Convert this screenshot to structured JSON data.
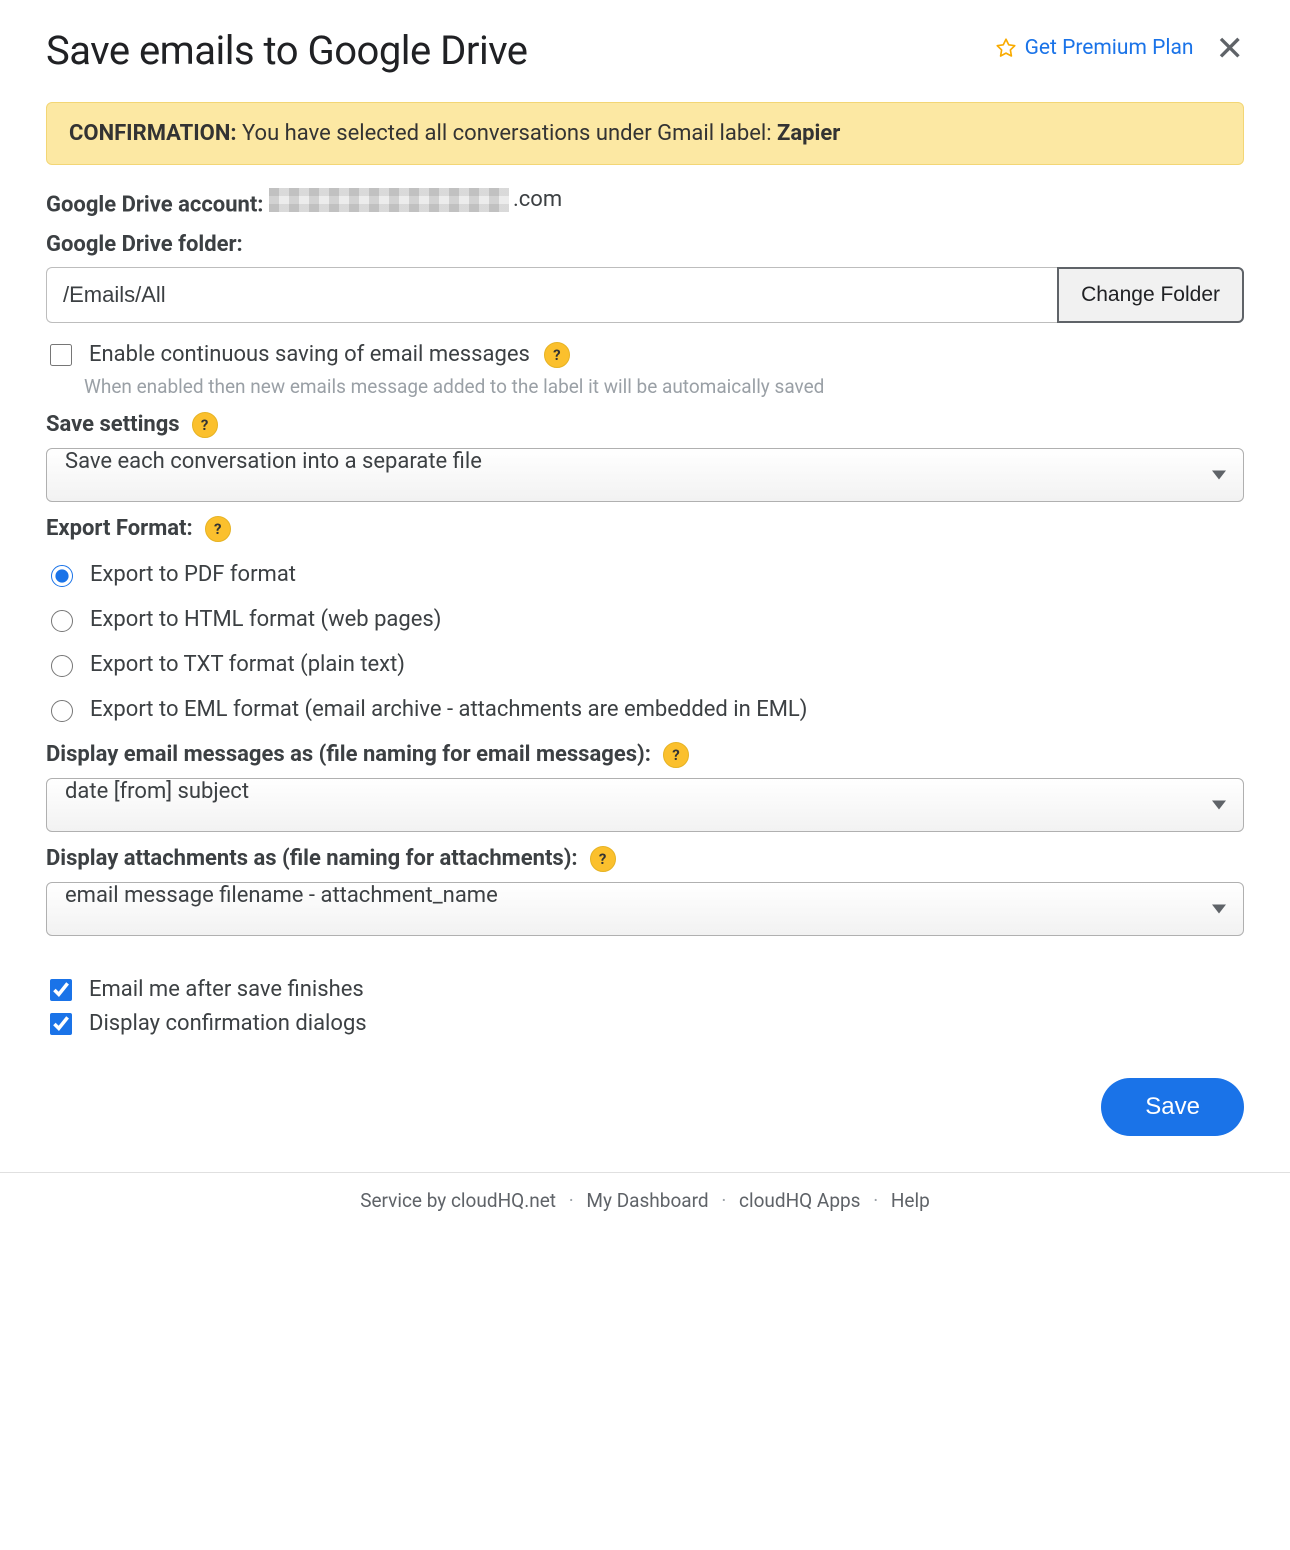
{
  "header": {
    "title": "Save emails to Google Drive",
    "premium_link": "Get Premium Plan"
  },
  "confirmation": {
    "prefix": "CONFIRMATION:",
    "text": "You have selected all conversations under Gmail label:",
    "label_name": "Zapier"
  },
  "account": {
    "label": "Google Drive account:",
    "suffix": ".com"
  },
  "folder": {
    "label": "Google Drive folder:",
    "value": "/Emails/All",
    "change_btn": "Change Folder"
  },
  "continuous": {
    "label": "Enable continuous saving of email messages",
    "hint": "When enabled then new emails message added to the label it will be automaically saved",
    "checked": false
  },
  "save_settings": {
    "label": "Save settings",
    "value": "Save each conversation into a separate file"
  },
  "export_format": {
    "label": "Export Format:",
    "options": [
      "Export to PDF format",
      "Export to HTML format (web pages)",
      "Export to TXT format (plain text)",
      "Export to EML format (email archive - attachments are embedded in EML)"
    ],
    "selected_index": 0
  },
  "display_messages": {
    "label": "Display email messages as (file naming for email messages):",
    "value": "date [from] subject"
  },
  "display_attachments": {
    "label": "Display attachments as (file naming for attachments):",
    "value": "email message filename - attachment_name"
  },
  "final_checks": {
    "email_after": {
      "label": "Email me after save finishes",
      "checked": true
    },
    "confirm_dialogs": {
      "label": "Display confirmation dialogs",
      "checked": true
    }
  },
  "buttons": {
    "save": "Save"
  },
  "footer": {
    "service_by": "Service by",
    "brand": "cloudHQ.net",
    "links": [
      "My Dashboard",
      "cloudHQ Apps",
      "Help"
    ]
  },
  "help_glyph": "?"
}
